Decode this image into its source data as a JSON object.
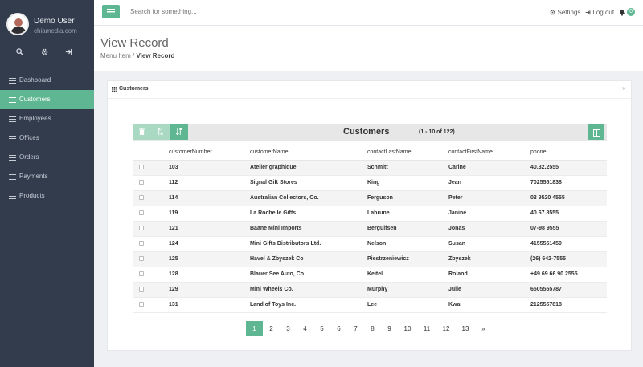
{
  "user": {
    "name": "Demo User",
    "site": "chiamedia.com"
  },
  "sidebar_icons": [
    {
      "name": "search-icon",
      "glyph": "⚲"
    },
    {
      "name": "gear-icon",
      "glyph": "⚙"
    },
    {
      "name": "logout-icon",
      "glyph": "⇥"
    }
  ],
  "sidebar": {
    "items": [
      {
        "label": "Dashboard"
      },
      {
        "label": "Customers",
        "active": true
      },
      {
        "label": "Employees"
      },
      {
        "label": "Offices"
      },
      {
        "label": "Orders"
      },
      {
        "label": "Payments"
      },
      {
        "label": "Products"
      }
    ]
  },
  "topbar": {
    "search_placeholder": "Search for something...",
    "settings_label": "Settings",
    "logout_label": "Log out",
    "notification_count": "0"
  },
  "header": {
    "title": "View Record",
    "breadcrumb_parent": "Menu Item",
    "breadcrumb_sep": " / ",
    "breadcrumb_current": "View Record"
  },
  "panel": {
    "title": "Customers",
    "close": "×"
  },
  "table": {
    "title": "Customers",
    "count": "(1 - 10 of 122)",
    "columns": [
      "customerNumber",
      "customerName",
      "contactLastName",
      "contactFirstName",
      "phone"
    ],
    "rows": [
      [
        "103",
        "Atelier graphique",
        "Schmitt",
        "Carine",
        "40.32.2555"
      ],
      [
        "112",
        "Signal Gift Stores",
        "King",
        "Jean",
        "7025551838"
      ],
      [
        "114",
        "Australian Collectors, Co.",
        "Ferguson",
        "Peter",
        "03 9520 4555"
      ],
      [
        "119",
        "La Rochelle Gifts",
        "Labrune",
        "Janine",
        "40.67.8555"
      ],
      [
        "121",
        "Baane Mini Imports",
        "Bergulfsen",
        "Jonas",
        "07-98 9555"
      ],
      [
        "124",
        "Mini Gifts Distributors Ltd.",
        "Nelson",
        "Susan",
        "4155551450"
      ],
      [
        "125",
        "Havel & Zbyszek Co",
        "Piestrzeniewicz",
        "Zbyszek",
        "(26) 642-7555"
      ],
      [
        "128",
        "Blauer See Auto, Co.",
        "Keitel",
        "Roland",
        "+49 69 66 90 2555"
      ],
      [
        "129",
        "Mini Wheels Co.",
        "Murphy",
        "Julie",
        "6505555787"
      ],
      [
        "131",
        "Land of Toys Inc.",
        "Lee",
        "Kwai",
        "2125557818"
      ]
    ]
  },
  "pagination": {
    "pages": [
      "1",
      "2",
      "3",
      "4",
      "5",
      "6",
      "7",
      "8",
      "9",
      "10",
      "11",
      "12",
      "13",
      "»"
    ],
    "current": "1"
  }
}
